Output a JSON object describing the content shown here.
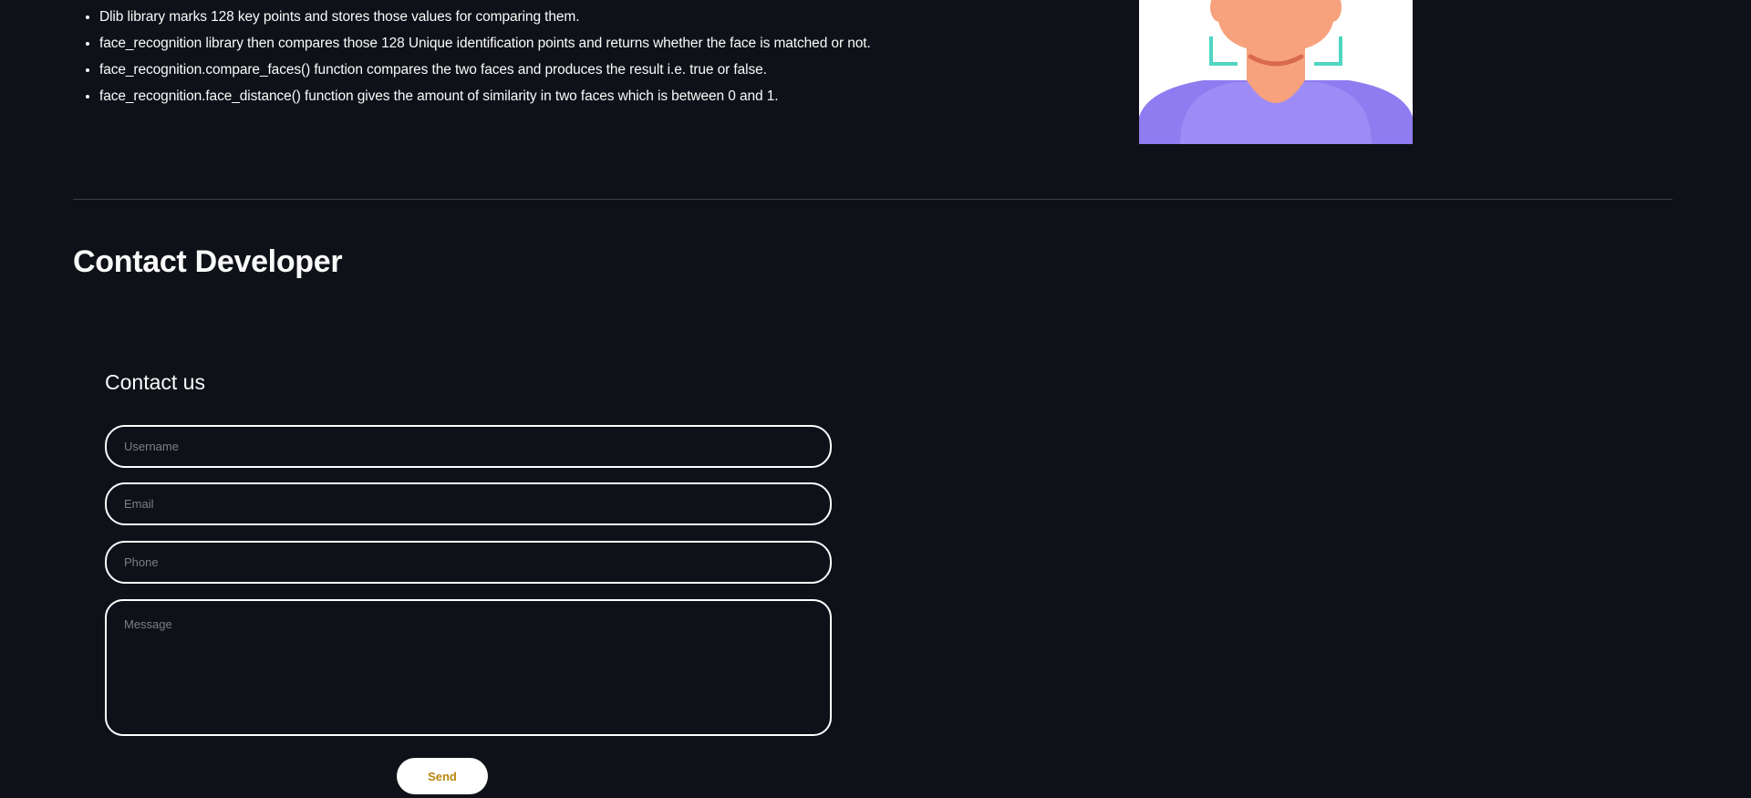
{
  "info": {
    "bullets": [
      "Dlib library marks 128 key points and stores those values for comparing them.",
      "face_recognition library then compares those 128 Unique identification points and returns whether the face is matched or not.",
      "face_recognition.compare_faces() function compares the two faces and produces the result i.e. true or false.",
      "face_recognition.face_distance() function gives the amount of similarity in two faces which is between 0 and 1."
    ],
    "illustration_icon": "face-scan-illustration"
  },
  "contact": {
    "section_title": "Contact Developer",
    "form_title": "Contact us",
    "username_placeholder": "Username",
    "email_placeholder": "Email",
    "phone_placeholder": "Phone",
    "message_placeholder": "Message",
    "send_label": "Send"
  },
  "colors": {
    "background": "#0e1117",
    "text": "#fafafa",
    "field_border": "#ffffff",
    "send_text": "#b8860b",
    "illustration_skin": "#f7a27c",
    "illustration_shirt": "#8f7cf0",
    "illustration_scan": "#4fd6c2"
  }
}
